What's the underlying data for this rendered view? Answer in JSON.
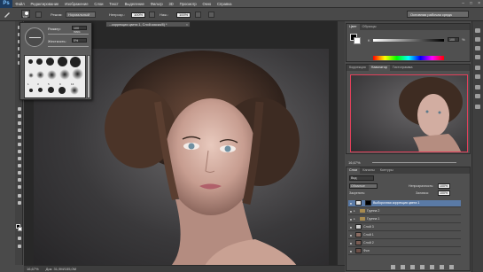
{
  "app": {
    "logo": "Ps",
    "menu": [
      "Файл",
      "Редактирование",
      "Изображение",
      "Слои",
      "Текст",
      "Выделение",
      "Фильтр",
      "3D",
      "Просмотр",
      "Окно",
      "Справка"
    ],
    "window_controls": [
      "–",
      "□",
      "×"
    ]
  },
  "options": {
    "brush_size": "100",
    "mode_label": "Режим:",
    "mode_value": "Нормальный",
    "opacity_label": "Непрозр.:",
    "opacity_value": "100%",
    "flow_label": "Наж.:",
    "flow_value": "100%",
    "workspace": "Основная рабочая среда"
  },
  "document": {
    "tab_title": "...коррекция цвета 1, Слой-маска/8) *",
    "tab_close": "×",
    "zoom": "16,67%",
    "doc_info": "Док: 31,9М/155,0М"
  },
  "brush_popup": {
    "size_label": "Размер:",
    "size_value": "100 пикс.",
    "hardness_label": "Жесткость:",
    "hardness_value": "0%",
    "preset_numbers": [
      "1",
      "3",
      "5",
      "9",
      "13",
      "19",
      "5",
      "9",
      "13",
      "17",
      "21",
      "27"
    ]
  },
  "color_panel": {
    "tabs": [
      "Цвет",
      "Образцы"
    ],
    "k_label": "K",
    "k_value": "100",
    "k_unit": "%"
  },
  "navigator_panel": {
    "tabs": [
      "Коррекция",
      "Навигатор",
      "Гистограмма"
    ],
    "zoom": "16,67%"
  },
  "layers_panel": {
    "tabs": [
      "Слои",
      "Каналы",
      "Контуры"
    ],
    "filter_label": "Вид",
    "blend_mode": "Обычные",
    "opacity_label": "Непрозрачность:",
    "opacity_value": "100%",
    "lock_label": "Закрепить:",
    "fill_label": "Заливка:",
    "fill_value": "100%",
    "layers": [
      {
        "name": "Выборочная коррекция цвета 1",
        "kind": "adjustment",
        "selected": true
      },
      {
        "name": "Группа 2",
        "kind": "group",
        "selected": false
      },
      {
        "name": "Группа 1",
        "kind": "group",
        "selected": false
      },
      {
        "name": "Слой 3",
        "kind": "pixel",
        "selected": false
      },
      {
        "name": "Слой 1",
        "kind": "pixel",
        "selected": false
      },
      {
        "name": "Слой 2",
        "kind": "pixel",
        "selected": false
      },
      {
        "name": "Фон",
        "kind": "pixel",
        "selected": false
      }
    ],
    "footer_icons": [
      "link-icon",
      "fx-icon",
      "mask-icon",
      "adjustment-icon",
      "folder-icon",
      "new-layer-icon",
      "trash-icon"
    ]
  },
  "colors": {
    "accent_selected": "#5a7aa6",
    "navigator_frame": "#e0405a"
  }
}
